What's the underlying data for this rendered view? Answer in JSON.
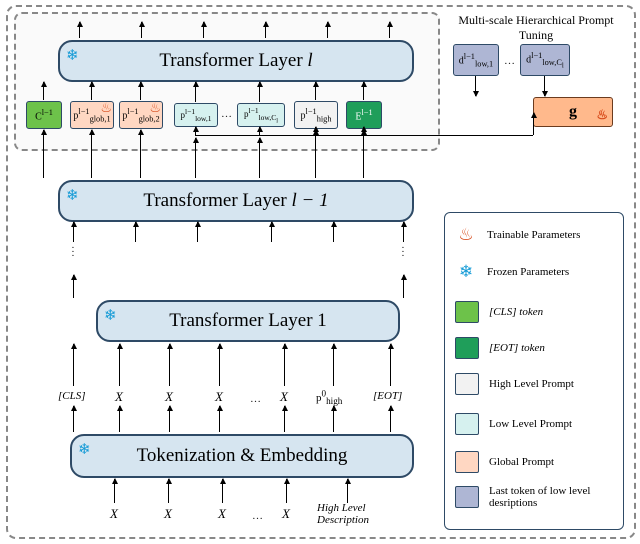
{
  "chart_data": {
    "type": "diagram",
    "title": "Multi-scale Hierarchical Prompt Tuning",
    "flow": [
      "Input X tokens + High Level Description",
      "Tokenization & Embedding",
      "[CLS] X ... X p_high^0 [EOT]",
      "Transformer Layer 1",
      "…",
      "Transformer Layer l-1",
      "C^{l-1}, p_glob,1^{l-1}, p_glob,2^{l-1}, p_low,1^{l-1} … p_low,Cl^{l-1}, p_high^{l-1}, E^{l-1}",
      "Transformer Layer l",
      "outputs"
    ],
    "side_module": {
      "name": "g",
      "inputs": [
        "d_low,1^{l-1}",
        "…",
        "d_low,Cl^{l-1}"
      ],
      "outputs_to": [
        "p_low,1^{l-1}",
        "…",
        "p_low,Cl^{l-1}"
      ]
    },
    "parameter_status": {
      "trainable": [
        "p_glob,1",
        "p_glob,2",
        "g"
      ],
      "frozen": [
        "Tokenization & Embedding",
        "Transformer Layer 1",
        "Transformer Layer l-1",
        "Transformer Layer l"
      ]
    }
  },
  "mpt_title": "Multi-scale Hierarchical Prompt Tuning",
  "blocks": {
    "layer_l_prefix": "Transformer Layer ",
    "layer_l_suffix": "l",
    "layer_lm1_prefix": "Transformer Layer ",
    "layer_lm1_suffix": "l − 1",
    "layer_1": "Transformer Layer 1",
    "tok_embed": "Tokenization & Embedding"
  },
  "tokens": {
    "cls": "C^{l−1}",
    "pg1": "p_{glob,1}^{l−1}",
    "pg2": "p_{glob,2}^{l−1}",
    "pl1": "p_{low,1}^{l−1}",
    "plc": "p_{low,C_l}^{l−1}",
    "phigh": "p_{high}^{l−1}",
    "eot": "E^{l−1}",
    "d1": "d_{low,1}^{l−1}",
    "dc": "d_{low,C_l}^{l−1}",
    "gfun": "g"
  },
  "labels_mid": {
    "CLS": "[CLS]",
    "X": "X",
    "phigh0": "p_{high}^{0}",
    "EOT": "[EOT]"
  },
  "bottom": {
    "X": "X",
    "hld1": "High Level",
    "hld2": "Description"
  },
  "legend": {
    "fire": "Trainable Parameters",
    "snow": "Frozen Parameters",
    "cls": "[CLS] token",
    "eot": "[EOT] token",
    "high": "High Level Prompt",
    "low": "Low Level Prompt",
    "glob": "Global Prompt",
    "dlow": "Last token of low level desriptions"
  }
}
